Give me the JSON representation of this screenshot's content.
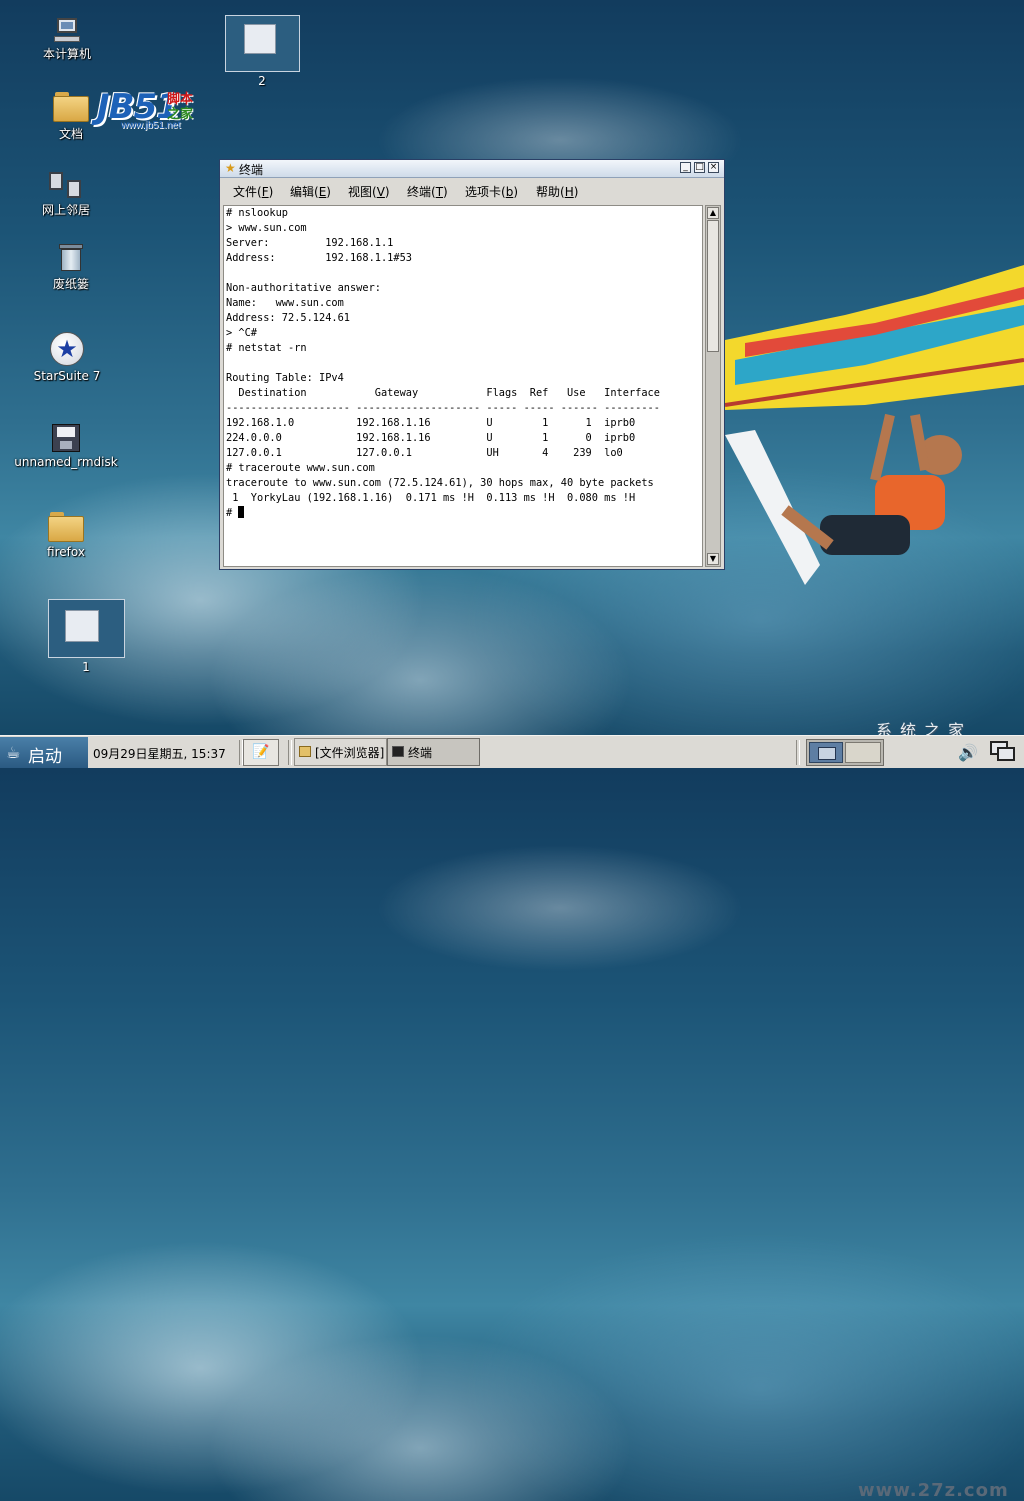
{
  "desktop": {
    "icons": [
      {
        "label": "本计算机",
        "icon": "computer-icon"
      },
      {
        "label": "文档",
        "icon": "folder-icon"
      },
      {
        "label": "网上邻居",
        "icon": "network-icon"
      },
      {
        "label": "废纸篓",
        "icon": "trash-icon"
      },
      {
        "label": "StarSuite 7",
        "icon": "starsuite-icon"
      },
      {
        "label": "unnamed_rmdisk",
        "icon": "floppy-disk-icon"
      },
      {
        "label": "firefox",
        "icon": "folder-icon"
      }
    ],
    "workspace_thumbnails": [
      {
        "label": "2"
      },
      {
        "label": "1"
      }
    ],
    "logo": {
      "big": "JB51",
      "cn_top": "脚本",
      "cn_bottom": "之家",
      "url": "www.jb51.net"
    },
    "watermark": {
      "top": "系统之家",
      "bottom": "www.27z.com"
    }
  },
  "terminal_window": {
    "title": "终端",
    "title_icon": "star-icon",
    "buttons": {
      "minimize": "_",
      "maximize": "□",
      "close": "×"
    },
    "menu": [
      {
        "label": "文件",
        "key": "F"
      },
      {
        "label": "编辑",
        "key": "E"
      },
      {
        "label": "视图",
        "key": "V"
      },
      {
        "label": "终端",
        "key": "T"
      },
      {
        "label": "选项卡",
        "key": "b"
      },
      {
        "label": "帮助",
        "key": "H"
      }
    ],
    "lines": [
      "# nslookup",
      "> www.sun.com",
      "Server:         192.168.1.1",
      "Address:        192.168.1.1#53",
      "",
      "Non-authoritative answer:",
      "Name:   www.sun.com",
      "Address: 72.5.124.61",
      "> ^C#",
      "# netstat -rn",
      "",
      "Routing Table: IPv4",
      "  Destination           Gateway           Flags  Ref   Use   Interface",
      "-------------------- -------------------- ----- ----- ------ ---------",
      "192.168.1.0          192.168.1.16         U        1      1  iprb0",
      "224.0.0.0            192.168.1.16         U        1      0  iprb0",
      "127.0.0.1            127.0.0.1            UH       4    239  lo0",
      "# traceroute www.sun.com",
      "traceroute to www.sun.com (72.5.124.61), 30 hops max, 40 byte packets",
      " 1  YorkyLau (192.168.1.16)  0.171 ms !H  0.113 ms !H  0.080 ms !H",
      "# "
    ]
  },
  "taskbar": {
    "start_label": "启动",
    "clock": "09月29日星期五, 15:37",
    "tasks": [
      {
        "label": "[文件浏览器]",
        "icon": "folder-icon",
        "active": false
      },
      {
        "label": "终端",
        "icon": "terminal-icon",
        "active": true
      }
    ],
    "tray": {
      "volume_icon": "speaker-icon",
      "screen_icon": "display-icon"
    }
  },
  "colors": {
    "title_gradient_top": "#f2f6fb",
    "title_gradient_bottom": "#cfdbe9",
    "taskbar_bg": "#dcdad5",
    "start_bg": "#2b5a82"
  }
}
